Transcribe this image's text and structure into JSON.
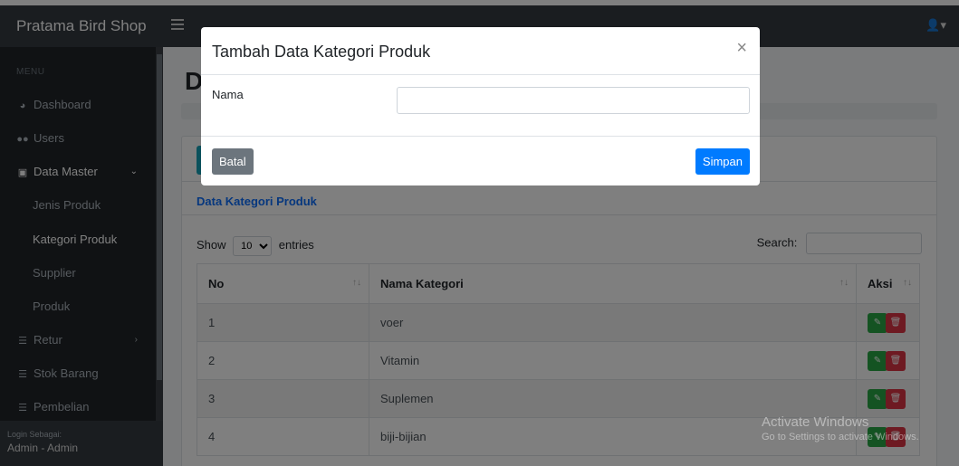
{
  "app": {
    "brand": "Pratama Bird Shop"
  },
  "sidebar": {
    "heading": "MENU",
    "items": [
      {
        "label": "Dashboard",
        "icon": "dashboard-icon"
      },
      {
        "label": "Users",
        "icon": "users-icon"
      },
      {
        "label": "Data Master",
        "icon": "database-icon"
      },
      {
        "label": "Jenis Produk"
      },
      {
        "label": "Kategori Produk"
      },
      {
        "label": "Supplier"
      },
      {
        "label": "Produk"
      },
      {
        "label": "Retur",
        "icon": "list-icon"
      },
      {
        "label": "Stok Barang",
        "icon": "list-icon"
      },
      {
        "label": "Pembelian",
        "icon": "list-icon"
      }
    ],
    "footer": {
      "label": "Login Sebagai:",
      "user": "Admin - Admin"
    }
  },
  "main": {
    "page_title_initial": "D",
    "card_title": "Data Kategori Produk",
    "length": {
      "show": "Show",
      "value": "10",
      "entries": "entries"
    },
    "search_label": "Search:",
    "table": {
      "headers": [
        "No",
        "Nama Kategori",
        "Aksi"
      ],
      "rows": [
        {
          "no": "1",
          "nama": "voer"
        },
        {
          "no": "2",
          "nama": "Vitamin"
        },
        {
          "no": "3",
          "nama": "Suplemen"
        },
        {
          "no": "4",
          "nama": "biji-bijian"
        }
      ]
    }
  },
  "modal": {
    "title": "Tambah Data Kategori Produk",
    "close": "×",
    "field_label": "Nama",
    "field_value": "",
    "cancel_label": "Batal",
    "save_label": "Simpan"
  },
  "watermark": {
    "line1": "Activate Windows",
    "line2": "Go to Settings to activate Windows."
  },
  "colors": {
    "topbar": "#343a40",
    "sidebar": "#212529",
    "primary": "#007bff",
    "secondary": "#6c757d",
    "success": "#28a745",
    "danger": "#dc3545"
  }
}
